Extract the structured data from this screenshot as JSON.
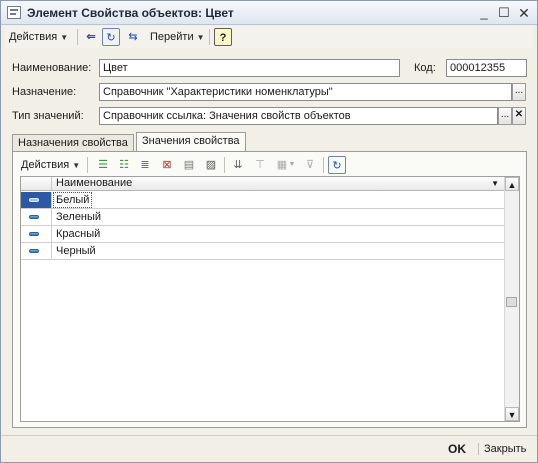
{
  "window": {
    "title": "Элемент Свойства объектов: Цвет"
  },
  "toolbar": {
    "actions_label": "Действия",
    "goto_label": "Перейти",
    "help_label": "?"
  },
  "form": {
    "name_label": "Наименование:",
    "name_value": "Цвет",
    "code_label": "Код:",
    "code_value": "000012355",
    "purpose_label": "Назначение:",
    "purpose_value": "Справочник  \"Характеристики номенклатуры\"",
    "type_label": "Тип значений:",
    "type_value": "Справочник ссылка: Значения свойств объектов",
    "select_button": "...",
    "clear_button": "✕"
  },
  "tabs": [
    {
      "label": "Назначения свойства",
      "active": false
    },
    {
      "label": "Значения свойства",
      "active": true
    }
  ],
  "values_panel": {
    "actions_label": "Действия",
    "column_header": "Наименование",
    "rows": [
      {
        "label": "Белый",
        "selected": true
      },
      {
        "label": "Зеленый",
        "selected": false
      },
      {
        "label": "Красный",
        "selected": false
      },
      {
        "label": "Черный",
        "selected": false
      }
    ]
  },
  "footer": {
    "ok_label": "OK",
    "close_label": "Закрыть"
  },
  "colors": {
    "selection": "#2c58a8",
    "window_bg": "#f2efe7"
  }
}
